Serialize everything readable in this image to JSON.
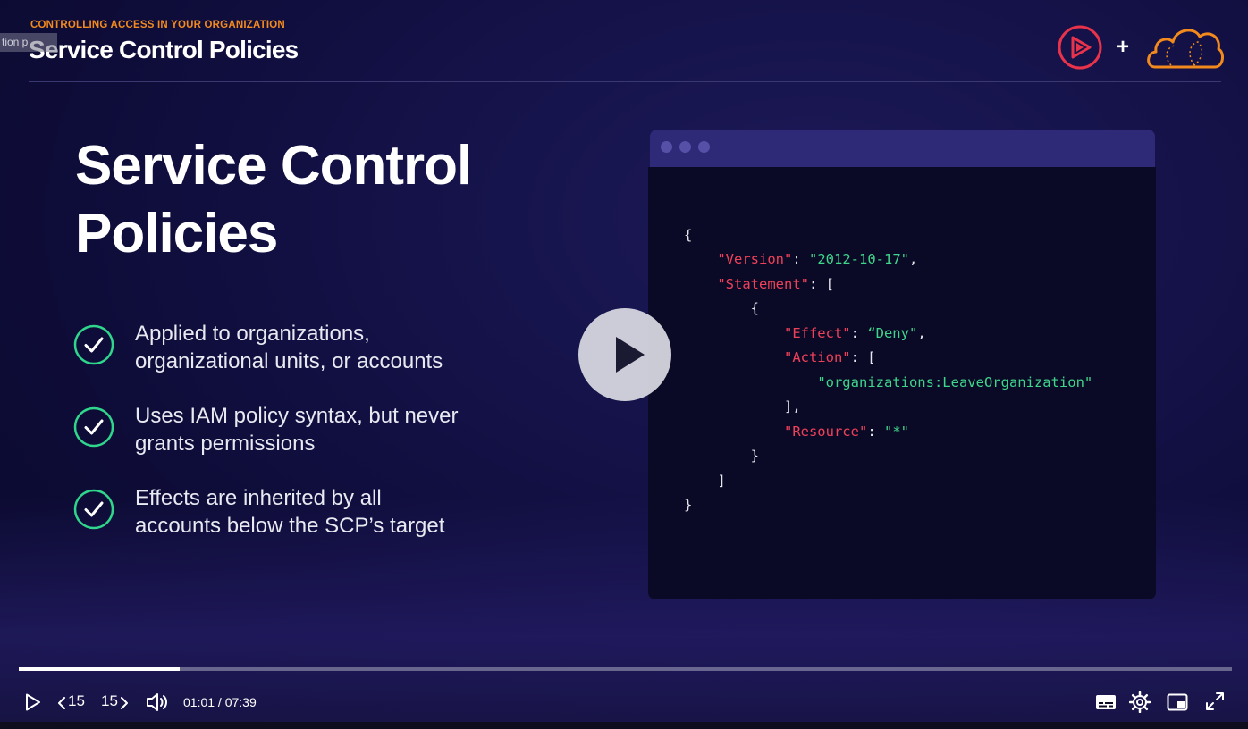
{
  "slide": {
    "kicker": "CONTROLLING ACCESS IN YOUR ORGANIZATION",
    "header_title": "Service Control Policies",
    "tooltip_fragment": "tion p",
    "title_line1": "Service Control",
    "title_line2": "Policies",
    "bullets": [
      {
        "line1": "Applied to organizations,",
        "line2": "organizational units, or accounts"
      },
      {
        "line1": "Uses IAM policy syntax, but never",
        "line2": "grants permissions"
      },
      {
        "line1": "Effects are inherited by all",
        "line2": "accounts below the SCP’s target"
      }
    ],
    "logo_plus": "+",
    "colors": {
      "accent_orange": "#f28a1e",
      "ps_red": "#e8334a",
      "check_green": "#2fd68c",
      "code_key": "#f0415a",
      "code_string": "#3fd68c"
    }
  },
  "code": {
    "l1": "{",
    "l2_key": "\"Version\"",
    "l2_sep": ": ",
    "l2_val": "\"2012-10-17\"",
    "l2_end": ",",
    "l3_key": "\"Statement\"",
    "l3_rest": ": [",
    "l4": "{",
    "l5_key": "\"Effect\"",
    "l5_sep": ": ",
    "l5_val": "“Deny\"",
    "l5_end": ",",
    "l6_key": "\"Action\"",
    "l6_rest": ": [",
    "l7_val": "\"organizations:LeaveOrganization\"",
    "l8": "],",
    "l9_key": "\"Resource\"",
    "l9_sep": ": ",
    "l9_val": "\"*\"",
    "l10": "}",
    "l11": "]",
    "l12": "}"
  },
  "player": {
    "progress_fraction": 0.133,
    "time_display": "01:01 / 07:39",
    "skip_back_label": "15",
    "skip_forward_label": "15",
    "icons": [
      "play-icon",
      "skip-back-icon",
      "skip-forward-icon",
      "volume-icon",
      "captions-icon",
      "settings-icon",
      "picture-in-picture-icon",
      "fullscreen-icon"
    ]
  }
}
